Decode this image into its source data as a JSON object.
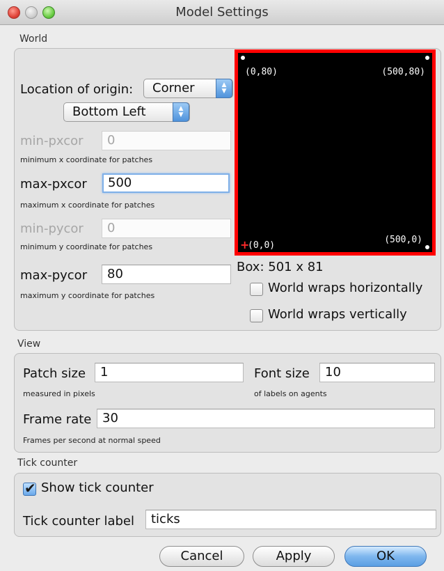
{
  "window": {
    "title": "Model Settings"
  },
  "world": {
    "section_label": "World",
    "origin_label": "Location of origin:",
    "origin_value": "Corner",
    "corner_value": "Bottom Left",
    "min_pxcor": {
      "label": "min-pxcor",
      "value": "0",
      "help": "minimum x coordinate for patches"
    },
    "max_pxcor": {
      "label": "max-pxcor",
      "value": "500",
      "help": "maximum x coordinate for patches"
    },
    "min_pycor": {
      "label": "min-pycor",
      "value": "0",
      "help": "minimum y coordinate for patches"
    },
    "max_pycor": {
      "label": "max-pycor",
      "value": "80",
      "help": "maximum y coordinate for patches"
    },
    "preview": {
      "top_left": "(0,80)",
      "top_right": "(500,80)",
      "bottom_left": "(0,0)",
      "bottom_right": "(500,0)"
    },
    "box_label": "Box: 501 x 81",
    "wrap_horizontal": {
      "label": "World wraps horizontally",
      "checked": false
    },
    "wrap_vertical": {
      "label": "World wraps vertically",
      "checked": false
    }
  },
  "view": {
    "section_label": "View",
    "patch_size": {
      "label": "Patch size",
      "value": "1",
      "help": "measured in pixels"
    },
    "font_size": {
      "label": "Font size",
      "value": "10",
      "help": "of labels on agents"
    },
    "frame_rate": {
      "label": "Frame rate",
      "value": "30",
      "help": "Frames per second at normal speed"
    }
  },
  "tick_counter": {
    "section_label": "Tick counter",
    "show": {
      "label": "Show tick counter",
      "checked": true
    },
    "label_field": {
      "label": "Tick counter label",
      "value": "ticks"
    }
  },
  "buttons": {
    "cancel": "Cancel",
    "apply": "Apply",
    "ok": "OK"
  },
  "colors": {
    "frame_red": "#ff0000",
    "default_button_blue": "#5b9fe3"
  }
}
